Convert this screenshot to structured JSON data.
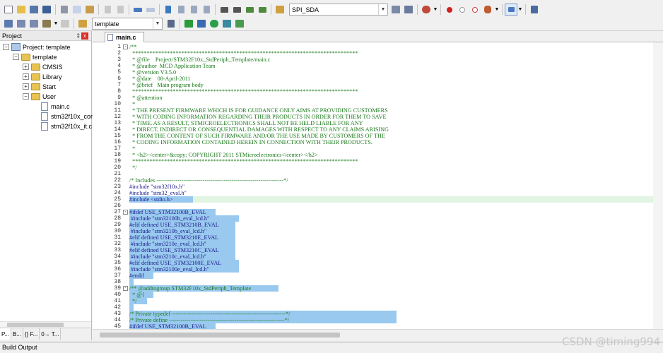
{
  "toolbar": {
    "symbol_combo": "SPI_SDA",
    "target_combo": "template"
  },
  "project_pane": {
    "title": "Project",
    "pin": "‡",
    "close": "x",
    "tree": {
      "project": "Project: template",
      "target": "template",
      "groups": [
        "CMSIS",
        "Library",
        "Start",
        "User"
      ],
      "files": [
        "main.c",
        "stm32f10x_cor",
        "stm32f10x_it.c"
      ]
    },
    "tabs": [
      "P...",
      "B...",
      "{} F...",
      "0→ T..."
    ]
  },
  "editor": {
    "active_tab": "main.c",
    "line_numbers": [
      "1",
      "2",
      "3",
      "4",
      "5",
      "6",
      "7",
      "8",
      "9",
      "10",
      "11",
      "12",
      "13",
      "14",
      "15",
      "16",
      "17",
      "18",
      "19",
      "20",
      "21",
      "22",
      "23",
      "24",
      "25",
      "26",
      "27",
      "28",
      "29",
      "30",
      "31",
      "32",
      "33",
      "34",
      "35",
      "36",
      "37",
      "38",
      "39",
      "40",
      "41",
      "42",
      "43",
      "44",
      "45"
    ],
    "lines": [
      "/**",
      "  ******************************************************************************",
      "  * @file    Project/STM32F10x_StdPeriph_Template/main.c",
      "  * @author  MCD Application Team",
      "  * @version V3.5.0",
      "  * @date    08-April-2011",
      "  * @brief   Main program body",
      "  ******************************************************************************",
      "  * @attention",
      "  *",
      "  * THE PRESENT FIRMWARE WHICH IS FOR GUIDANCE ONLY AIMS AT PROVIDING CUSTOMERS",
      "  * WITH CODING INFORMATION REGARDING THEIR PRODUCTS IN ORDER FOR THEM TO SAVE",
      "  * TIME. AS A RESULT, STMICROELECTRONICS SHALL NOT BE HELD LIABLE FOR ANY",
      "  * DIRECT, INDIRECT OR CONSEQUENTIAL DAMAGES WITH RESPECT TO ANY CLAIMS ARISING",
      "  * FROM THE CONTENT OF SUCH FIRMWARE AND/OR THE USE MADE BY CUSTOMERS OF THE",
      "  * CODING INFORMATION CONTAINED HEREIN IN CONNECTION WITH THEIR PRODUCTS.",
      "  *",
      "  * <h2><center>&copy; COPYRIGHT 2011 STMicroelectronics</center></h2>",
      "  ******************************************************************************",
      "  */",
      "",
      "/* Includes ------------------------------------------------------------------*/",
      "#include \"stm32f10x.h\"",
      "#include \"stm32_eval.h\"",
      "#include <stdio.h>",
      "",
      "#ifdef USE_STM32100B_EVAL",
      " #include \"stm32100b_eval_lcd.h\"",
      "#elif defined USE_STM3210B_EVAL",
      " #include \"stm3210b_eval_lcd.h\"",
      "#elif defined USE_STM3210E_EVAL",
      " #include \"stm3210e_eval_lcd.h\"",
      "#elif defined USE_STM3210C_EVAL",
      " #include \"stm3210c_eval_lcd.h\"",
      "#elif defined USE_STM32100E_EVAL",
      " #include \"stm32100e_eval_lcd.h\"",
      "#endif",
      "",
      "/** @addtogroup STM32F10x_StdPeriph_Template",
      "  * @{",
      "  */",
      "",
      "/* Private typedef -----------------------------------------------------------*/",
      "/* Private define ------------------------------------------------------------*/",
      "#ifdef USE_STM32100B_EVAL"
    ]
  },
  "bottom": {
    "build_output": "Build Output"
  },
  "watermark": "CSDN @timing994"
}
